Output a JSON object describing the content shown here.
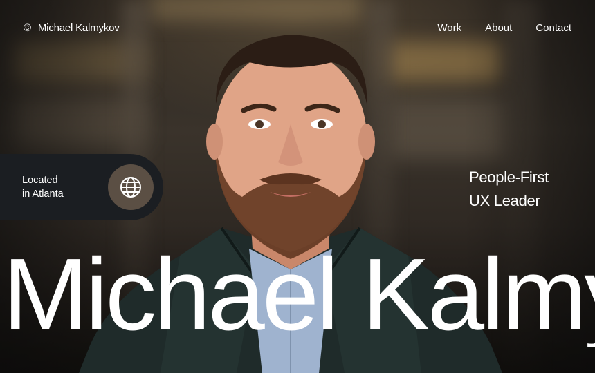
{
  "header": {
    "brand_symbol": "©",
    "brand_name": "Michael Kalmykov",
    "nav": [
      {
        "label": "Work"
      },
      {
        "label": "About"
      },
      {
        "label": "Contact"
      }
    ]
  },
  "location": {
    "line1": "Located",
    "line2": "in Atlanta",
    "icon": "globe-icon"
  },
  "tagline": {
    "line1": "People-First",
    "line2": "UX Leader"
  },
  "hero": {
    "name": "Michael Kalmy"
  },
  "colors": {
    "text": "#ffffff",
    "pill_bg": "#1b1e22",
    "globe_bg": "#5b4f44"
  }
}
